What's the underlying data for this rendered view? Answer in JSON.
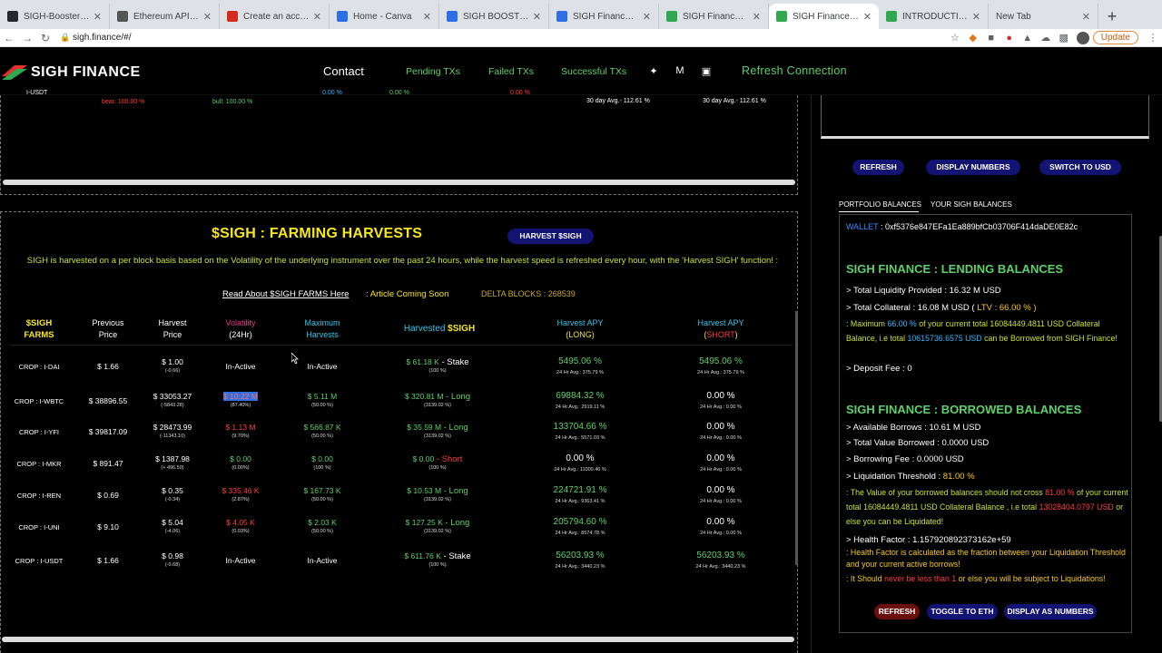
{
  "browser": {
    "tabs": [
      {
        "label": "SIGH-Boosters-sub-",
        "fav": "#24292e"
      },
      {
        "label": "Ethereum API | IPFS",
        "fav": "#555"
      },
      {
        "label": "Create an account - ",
        "fav": "#d52b1e"
      },
      {
        "label": "Home - Canva",
        "fav": "#2e6fe6"
      },
      {
        "label": "SIGH BOOSTERS : L",
        "fav": "#2e6fe6"
      },
      {
        "label": "SIGH Finance: Financ",
        "fav": "#2e6fe6"
      },
      {
        "label": "SIGH Finance | Engin",
        "fav": "#2fa84f"
      },
      {
        "label": "SIGH Finance | Engin",
        "fav": "#2fa84f"
      },
      {
        "label": "INTRODUCTION - S",
        "fav": "#2fa84f"
      },
      {
        "label": "New Tab",
        "fav": ""
      }
    ],
    "active_tab": 7,
    "url": "sigh.finance/#/",
    "update_label": "Update"
  },
  "header": {
    "logo_text": "SIGH FINANCE",
    "contact": "Contact",
    "pending": "Pending TXs",
    "failed": "Failed TXs",
    "successful": "Successful TXs",
    "refresh_connection": "Refresh Connection"
  },
  "top_panel": {
    "row_label": "I-USDT",
    "bear": "bear: 100.00 %",
    "bull": "bull: 100.00 %",
    "v1": "0.00 %",
    "v2": "0.00 %",
    "v3": "0.00 %",
    "avg1": "30 day Avg.- 112.61 %",
    "avg2": "30 day Avg.- 112.61 %"
  },
  "farms": {
    "title": "$SIGH : FARMING HARVESTS",
    "harvest_button": "HARVEST $SIGH",
    "description": "SIGH is harvested on a per block basis based on the Volatility of the underlying instrument over the past 24 hours, while the harvest speed is refreshed every hour, with the 'Harvest SIGH' function! :",
    "read_about": "Read About $SIGH FARMS Here",
    "coming_soon": ":  Article Coming Soon",
    "delta_blocks": "DELTA BLOCKS : 268539",
    "headers": {
      "farms_1": "$SIGH",
      "farms_2": "FARMS",
      "prev_1": "Previous",
      "prev_2": "Price",
      "harvest_price_1": "Harvest",
      "harvest_price_2": "Price",
      "vol_1": "Volatility",
      "vol_2": "(24Hr)",
      "max_1": "Maximum",
      "max_2": "Harvests",
      "harvested_1": "Harvested",
      "harvested_2": "$SIGH",
      "apy_long_1": "Harvest APY",
      "apy_long_2": "(LONG)",
      "apy_short_1": "Harvest APY",
      "apy_short_pre": "(",
      "apy_short_2": "SHORT",
      "apy_short_post": ")"
    },
    "rows": [
      {
        "name": "CROP : I-DAI",
        "prev": "$ 1.66",
        "hp": "$ 1.00",
        "hp_sub": "(-0.66)",
        "vol": "In-Active",
        "vol_sub": "",
        "max": "In-Active",
        "max_sub": "",
        "harv": "$ 61.18 K",
        "harv_type": " - Stake",
        "harv_sub": "(100 %)",
        "long": "5495.06 %",
        "long_sub": "24 Hr Avg.: 375.79 %",
        "short": "5495.06 %",
        "short_sub": "24 Hr Avg.: 375.79 %"
      },
      {
        "name": "CROP : I-WBTC",
        "prev": "$ 38896.55",
        "hp": "$ 33053.27",
        "hp_sub": "(-5843.28)",
        "vol": "$ 10.22 M",
        "vol_sub": "(87.40%)",
        "max": "$ 5.11 M",
        "max_sub": "(50.00 %)",
        "harv": "$ 320.81 M",
        "harv_type": " - Long",
        "harv_sub": "(3139.02 %)",
        "long": "69884.32 %",
        "long_sub": "24 Hr Avg.: 2919.11 %",
        "short": "0.00 %",
        "short_sub": "24 Hr Avg.: 0.00 %"
      },
      {
        "name": "CROP : I-YFI",
        "prev": "$ 39817.09",
        "hp": "$ 28473.99",
        "hp_sub": "(-11343.10)",
        "vol": "$ 1.13 M",
        "vol_sub": "(9.70%)",
        "max": "$ 566.87 K",
        "max_sub": "(50.00 %)",
        "harv": "$ 35.59 M",
        "harv_type": " - Long",
        "harv_sub": "(3139.02 %)",
        "long": "133704.66 %",
        "long_sub": "24 Hr Avg.: 5571.03 %",
        "short": "0.00 %",
        "short_sub": "24 Hr Avg.: 0.00 %"
      },
      {
        "name": "CROP : I-MKR",
        "prev": "$ 891.47",
        "hp": "$ 1387.98",
        "hp_sub": "(+ 496.50)",
        "vol": "$ 0.00",
        "vol_sub": "(0.00%)",
        "max": "$ 0.00",
        "max_sub": "(100 %)",
        "harv": "$ 0.00",
        "harv_type": " - Short",
        "harv_sub": "(100 %)",
        "long": "0.00 %",
        "long_sub": "24 Hr Avg.: 11000.46 %",
        "short": "0.00 %",
        "short_sub": "24 Hr Avg.: 0.00 %"
      },
      {
        "name": "CROP : I-REN",
        "prev": "$ 0.69",
        "hp": "$ 0.35",
        "hp_sub": "(-0.34)",
        "vol": "$ 335.46 K",
        "vol_sub": "(2.87%)",
        "max": "$ 167.73 K",
        "max_sub": "(50.00 %)",
        "harv": "$ 10.53 M",
        "harv_type": " - Long",
        "harv_sub": "(3139.02 %)",
        "long": "224721.91 %",
        "long_sub": "24 Hr Avg.: 9363.41 %",
        "short": "0.00 %",
        "short_sub": "24 Hr Avg.: 0.00 %"
      },
      {
        "name": "CROP : I-UNI",
        "prev": "$ 9.10",
        "hp": "$ 5.04",
        "hp_sub": "(-4.06)",
        "vol": "$ 4.05 K",
        "vol_sub": "(0.03%)",
        "max": "$ 2.03 K",
        "max_sub": "(50.00 %)",
        "harv": "$ 127.25 K",
        "harv_type": " - Long",
        "harv_sub": "(3139.02 %)",
        "long": "205794.60 %",
        "long_sub": "24 Hr Avg.: 8574.78 %",
        "short": "0.00 %",
        "short_sub": "24 Hr Avg.: 0.00 %"
      },
      {
        "name": "CROP : I-USDT",
        "prev": "$ 1.66",
        "hp": "$ 0.98",
        "hp_sub": "(-0.68)",
        "vol": "In-Active",
        "vol_sub": "",
        "max": "In-Active",
        "max_sub": "",
        "harv": "$ 611.76 K",
        "harv_type": " - Stake",
        "harv_sub": "(100 %)",
        "long": "56203.93 %",
        "long_sub": "24 Hr Avg.: 3440.23 %",
        "short": "56203.93 %",
        "short_sub": "24 Hr Avg.: 3440.23 %"
      }
    ]
  },
  "right": {
    "buttons_top": {
      "refresh": "REFRESH",
      "display_numbers": "DISPLAY NUMBERS",
      "switch_usd": "SWITCH TO USD"
    },
    "tabs": {
      "portfolio": "PORTFOLIO BALANCES",
      "sigh": "YOUR SIGH BALANCES"
    },
    "wallet_label": "WALLET",
    "wallet_addr": " : 0xf5376e847EFa1Ea889bfCb03706F414daDE0E82c",
    "lending": {
      "title": "SIGH FINANCE : LENDING BALANCES",
      "total_liquidity": ">   Total Liquidity Provided   :   16.32 M USD",
      "collateral_pre": ">   Total Collateral   :   16.08 M USD  ( ",
      "ltv": "LTV  :   66.00 %",
      "collateral_post": " )",
      "max_p1": ": Maximum ",
      "max_pct": "66.00 %",
      "max_p2": " of your current total 16084449.4811 USD Collateral Balance, i.e total ",
      "max_amt": "10615736.6575 USD",
      "max_p3": " can be Borrowed from SIGH Finance!",
      "deposit_fee": ">   Deposit Fee   :   0"
    },
    "borrowed": {
      "title": "SIGH FINANCE : BORROWED BALANCES",
      "available": ">   Available Borrows   :  10.61 M USD",
      "total_borrowed": ">   Total Value Borrowed   :   0.0000 USD",
      "borrow_fee": ">   Borrowing Fee   :   0.0000 USD",
      "liq_pre": ">   Liquidation Threshold   :   ",
      "liq_val": "81.00 %",
      "warn_p1": ": The Value of your borrowed balances should not cross ",
      "warn_pct": "81.00 %",
      "warn_p2": " of your current total 16084449.4811 USD Collateral Balance , i.e total ",
      "warn_amt": "13028404.0797 USD",
      "warn_p3": " or else you can be Liquidated!",
      "health": ">   Health Factor   :   1.157920892373162e+59",
      "hf_p1": ": Health Factor is calculated as the fraction between your Liquidation Threshold and your current active borrows!",
      "hf_p2a": ": It Should ",
      "hf_never": "never be less than 1",
      "hf_p2b": " or else you will be subject to Liquidations!"
    },
    "buttons_bottom": {
      "refresh": "REFRESH",
      "toggle_eth": "TOGGLE TO ETH",
      "display_numbers": "DISPLAY AS NUMBERS"
    }
  }
}
